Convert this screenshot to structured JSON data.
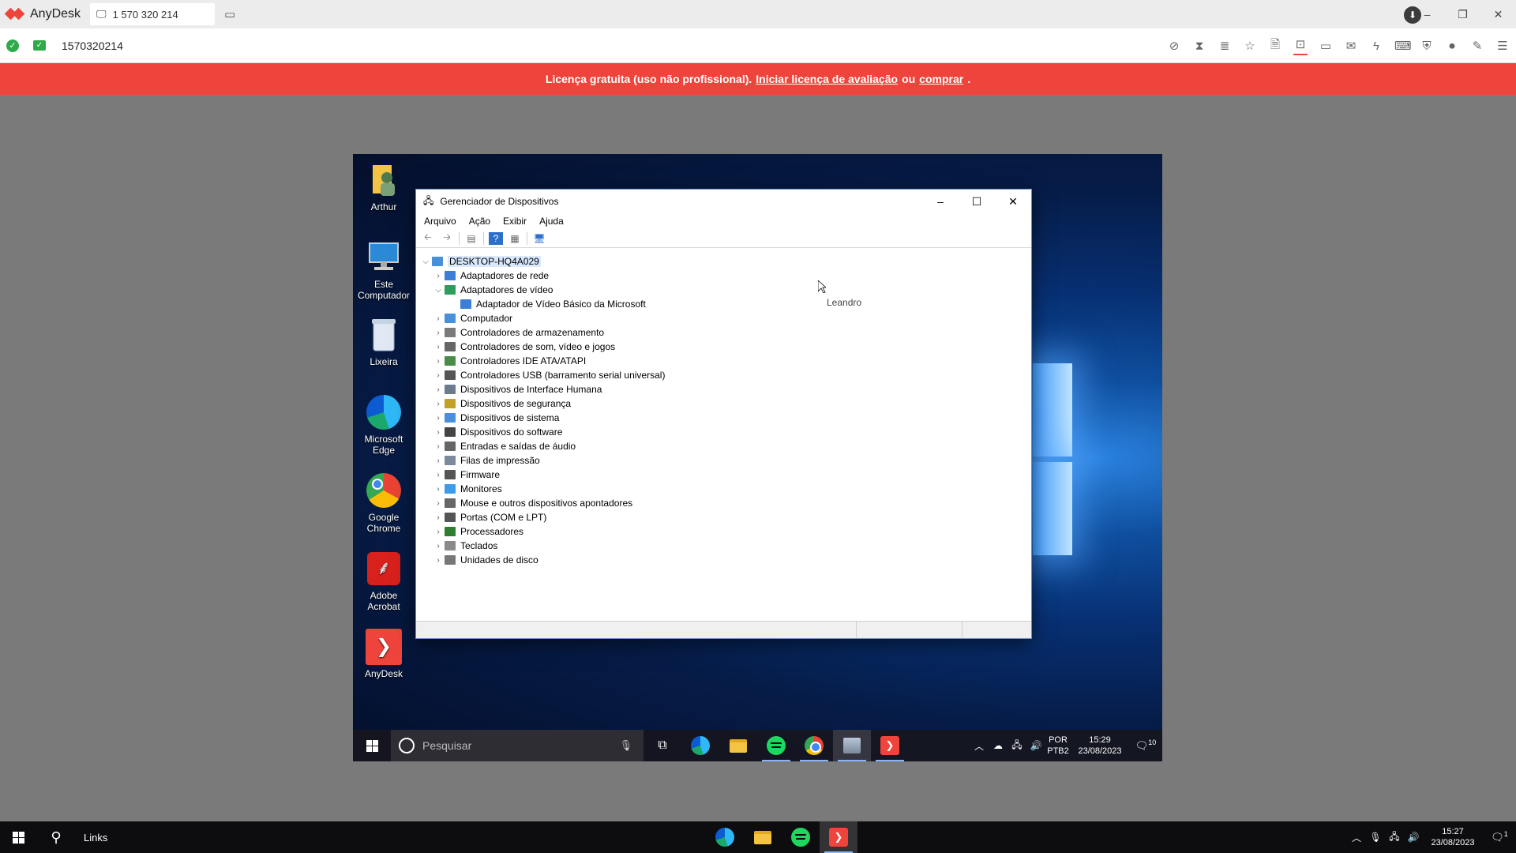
{
  "anydesk": {
    "app_name": "AnyDesk",
    "tab_label": "1 570 320 214",
    "address": "1570320214",
    "window_controls": {
      "minimize": "–",
      "restore": "❐",
      "close": "✕"
    }
  },
  "license": {
    "text_before": "Licença gratuita (uso não profissional).",
    "trial_link": "Iniciar licença de avaliação",
    "text_or": "ou",
    "buy_link": "comprar",
    "text_end": "."
  },
  "desktop_icons": [
    {
      "label": "Arthur"
    },
    {
      "label": "Este Computador"
    },
    {
      "label": "Lixeira"
    },
    {
      "label": "Microsoft Edge"
    },
    {
      "label": "Google Chrome"
    },
    {
      "label": "Adobe Acrobat"
    },
    {
      "label": "AnyDesk"
    }
  ],
  "device_manager": {
    "title": "Gerenciador de Dispositivos",
    "menu": [
      "Arquivo",
      "Ação",
      "Exibir",
      "Ajuda"
    ],
    "root": "DESKTOP-HQ4A029",
    "nodes": [
      {
        "label": "Adaptadores de rede",
        "expanded": false,
        "color": "#3d7fd6"
      },
      {
        "label": "Adaptadores de vídeo",
        "expanded": true,
        "color": "#2e9c5a"
      },
      {
        "label": "Adaptador de Vídeo Básico da Microsoft",
        "child": true,
        "color": "#3d7fd6"
      },
      {
        "label": "Computador",
        "expanded": false,
        "color": "#4a90d9"
      },
      {
        "label": "Controladores de armazenamento",
        "expanded": false,
        "color": "#7a7a7a"
      },
      {
        "label": "Controladores de som, vídeo e jogos",
        "expanded": false,
        "color": "#666666"
      },
      {
        "label": "Controladores IDE ATA/ATAPI",
        "expanded": false,
        "color": "#4a8c4a"
      },
      {
        "label": "Controladores USB (barramento serial universal)",
        "expanded": false,
        "color": "#555555"
      },
      {
        "label": "Dispositivos de Interface Humana",
        "expanded": false,
        "color": "#6c7b8c"
      },
      {
        "label": "Dispositivos de segurança",
        "expanded": false,
        "color": "#c2a02a"
      },
      {
        "label": "Dispositivos de sistema",
        "expanded": false,
        "color": "#4a90d9"
      },
      {
        "label": "Dispositivos do software",
        "expanded": false,
        "color": "#444444"
      },
      {
        "label": "Entradas e saídas de áudio",
        "expanded": false,
        "color": "#666666"
      },
      {
        "label": "Filas de impressão",
        "expanded": false,
        "color": "#7a8a9c"
      },
      {
        "label": "Firmware",
        "expanded": false,
        "color": "#555555"
      },
      {
        "label": "Monitores",
        "expanded": false,
        "color": "#3d9be9"
      },
      {
        "label": "Mouse e outros dispositivos apontadores",
        "expanded": false,
        "color": "#666666"
      },
      {
        "label": "Portas (COM e LPT)",
        "expanded": false,
        "color": "#555555"
      },
      {
        "label": "Processadores",
        "expanded": false,
        "color": "#2e7d32"
      },
      {
        "label": "Teclados",
        "expanded": false,
        "color": "#8a8a8a"
      },
      {
        "label": "Unidades de disco",
        "expanded": false,
        "color": "#777777"
      }
    ]
  },
  "remote_cursor": {
    "label": "Leandro"
  },
  "remote_taskbar": {
    "search_placeholder": "Pesquisar",
    "lang": [
      "POR",
      "PTB2"
    ],
    "time": "15:29",
    "date": "23/08/2023",
    "notification_count": "10"
  },
  "local_taskbar": {
    "links_label": "Links",
    "time": "15:27",
    "date": "23/08/2023",
    "notification_count": "1"
  }
}
